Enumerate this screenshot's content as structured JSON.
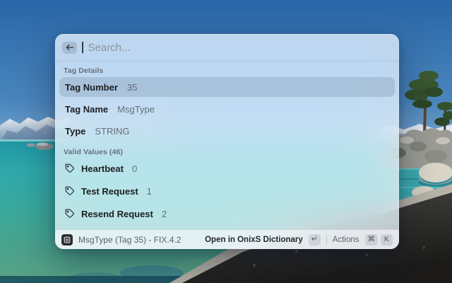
{
  "search": {
    "placeholder": "Search...",
    "value": "",
    "back_icon": "arrow-left-icon"
  },
  "tag_details": {
    "header": "Tag Details",
    "rows": [
      {
        "label": "Tag Number",
        "value": "35",
        "selected": true
      },
      {
        "label": "Tag Name",
        "value": "MsgType",
        "selected": false
      },
      {
        "label": "Type",
        "value": "STRING",
        "selected": false
      }
    ]
  },
  "valid_values": {
    "header": "Valid Values (46)",
    "items": [
      {
        "icon": "tag-icon",
        "label": "Heartbeat",
        "value": "0"
      },
      {
        "icon": "tag-icon",
        "label": "Test Request",
        "value": "1"
      },
      {
        "icon": "tag-icon",
        "label": "Resend Request",
        "value": "2"
      }
    ]
  },
  "footer": {
    "app_icon": "dictionary-app-icon",
    "title": "MsgType (Tag 35) - FIX.4.2",
    "primary_action": {
      "label": "Open in OnixS Dictionary",
      "key": "↵"
    },
    "secondary_action": {
      "label": "Actions",
      "keys": [
        "⌘",
        "K"
      ]
    }
  },
  "colors": {
    "selection_highlight": "#bccddb",
    "panel_tint": "#e9f1f7",
    "sky_top": "#2a66a8",
    "water_teal": "#2fa9ab",
    "rock_dark": "#1c1b19"
  }
}
